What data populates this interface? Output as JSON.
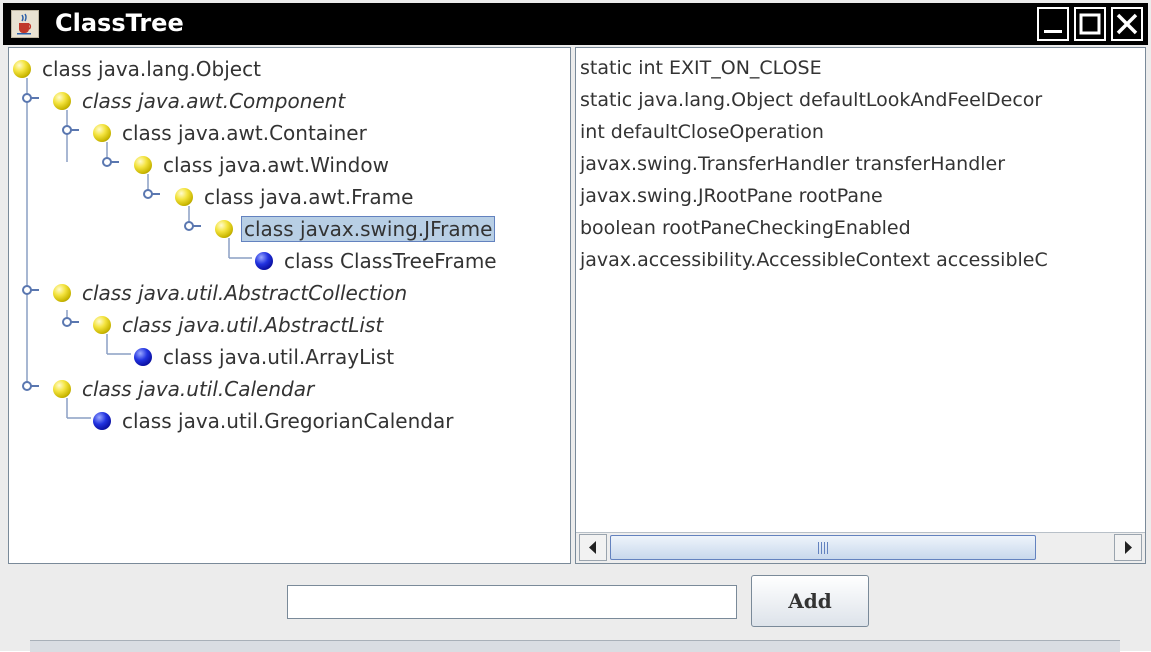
{
  "window": {
    "title": "ClassTree"
  },
  "tree": {
    "nodes": [
      {
        "label": "class java.lang.Object",
        "italic": false,
        "icon": "yellow-ball-icon"
      },
      {
        "label": "class java.awt.Component",
        "italic": true,
        "icon": "yellow-ball-icon"
      },
      {
        "label": "class java.awt.Container",
        "italic": false,
        "icon": "yellow-ball-icon"
      },
      {
        "label": "class java.awt.Window",
        "italic": false,
        "icon": "yellow-ball-icon"
      },
      {
        "label": "class java.awt.Frame",
        "italic": false,
        "icon": "yellow-ball-icon"
      },
      {
        "label": "class javax.swing.JFrame",
        "italic": false,
        "icon": "yellow-ball-icon",
        "selected": true
      },
      {
        "label": "class ClassTreeFrame",
        "italic": false,
        "icon": "blue-ball-icon"
      },
      {
        "label": "class java.util.AbstractCollection",
        "italic": true,
        "icon": "yellow-ball-icon"
      },
      {
        "label": "class java.util.AbstractList",
        "italic": true,
        "icon": "yellow-ball-icon"
      },
      {
        "label": "class java.util.ArrayList",
        "italic": false,
        "icon": "blue-ball-icon"
      },
      {
        "label": "class java.util.Calendar",
        "italic": true,
        "icon": "yellow-ball-icon"
      },
      {
        "label": "class java.util.GregorianCalendar",
        "italic": false,
        "icon": "blue-ball-icon"
      }
    ]
  },
  "fields": {
    "items": [
      "static int EXIT_ON_CLOSE",
      "static java.lang.Object defaultLookAndFeelDecor",
      "int defaultCloseOperation",
      "javax.swing.TransferHandler transferHandler",
      "javax.swing.JRootPane rootPane",
      "boolean rootPaneCheckingEnabled",
      "javax.accessibility.AccessibleContext accessibleC"
    ]
  },
  "addbar": {
    "input_value": "",
    "add_label": "Add"
  },
  "colors": {
    "selection": "#b8cfe5",
    "selection_border": "#6382bf",
    "titlebar": "#000000"
  }
}
